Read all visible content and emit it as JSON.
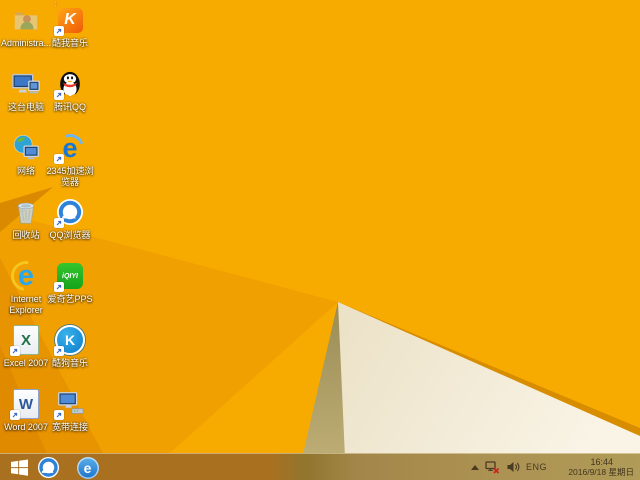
{
  "wallpaper": {
    "base_color": "#F7AB00",
    "fold_mid": "#F0A000",
    "fold_dark": "#E79400",
    "fold_darker": "#E08A00",
    "wedge_color": "#DA8A00",
    "rim_color": "#D88C00",
    "shadow_top": "#998C54",
    "shadow_bottom": "#C2B27A",
    "paper_dark": "#EBE1C6",
    "paper_light": "#F9F4E6"
  },
  "desktop": {
    "icons": [
      {
        "name": "administrator-folder",
        "label": "Administra...",
        "shortcut": false
      },
      {
        "name": "kuwo-music",
        "label": "酷我音乐",
        "glyph": "K",
        "note": "♪",
        "shortcut": true
      },
      {
        "name": "this-pc",
        "label": "这台电脑",
        "shortcut": false
      },
      {
        "name": "tencent-qq",
        "label": "腾讯QQ",
        "shortcut": true
      },
      {
        "name": "network",
        "label": "网络",
        "shortcut": false
      },
      {
        "name": "2345-browser",
        "label": "2345加速浏\n览器",
        "glyph": "e",
        "shortcut": true
      },
      {
        "name": "recycle-bin",
        "label": "回收站",
        "shortcut": false
      },
      {
        "name": "qq-browser",
        "label": "QQ浏览器",
        "shortcut": true
      },
      {
        "name": "internet-explorer",
        "label": "Internet\nExplorer",
        "glyph": "e",
        "shortcut": false
      },
      {
        "name": "iqiyi-pps",
        "label": "爱奇艺PPS",
        "glyph": "iQIYI",
        "shortcut": true
      },
      {
        "name": "excel-2007",
        "label": "Excel 2007",
        "glyph": "X",
        "shortcut": true
      },
      {
        "name": "kugou-music",
        "label": "酷狗音乐",
        "glyph": "K",
        "shortcut": true
      },
      {
        "name": "word-2007",
        "label": "Word 2007",
        "glyph": "W",
        "shortcut": true
      },
      {
        "name": "broadband-connection",
        "label": "宽带连接",
        "shortcut": true
      }
    ]
  },
  "taskbar": {
    "pinned": [
      {
        "name": "qq-browser-taskbar",
        "glyph": ""
      },
      {
        "name": "browser-e-taskbar",
        "glyph": "e"
      }
    ],
    "tray": {
      "language": "ENG",
      "time": "16:44",
      "date": "2016/9/18 星期日"
    }
  }
}
